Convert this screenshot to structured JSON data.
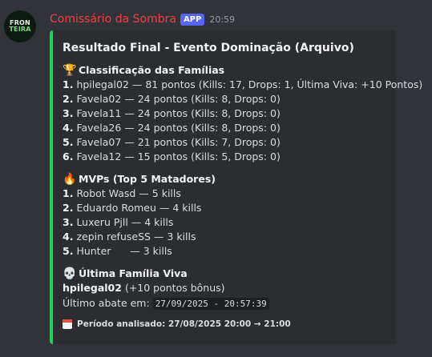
{
  "message": {
    "avatar_lines": [
      "FRON",
      "TEIRA"
    ],
    "author": "Comissário da Sombra",
    "app_tag": "APP",
    "time": "20:59"
  },
  "embed": {
    "accent_color": "#23d160",
    "title": "Resultado Final - Evento Dominação (Arquivo)",
    "families": {
      "heading": "Classificação das Famílias",
      "icon": "trophy-icon",
      "rows": [
        {
          "rank": "1.",
          "text": "hpilegal02 — 81 pontos (Kills: 17, Drops: 1, Última Viva: +10 Pontos)"
        },
        {
          "rank": "2.",
          "text": "Favela02 — 24 pontos (Kills: 8, Drops: 0)"
        },
        {
          "rank": "3.",
          "text": "Favela11 — 24 pontos (Kills: 8, Drops: 0)"
        },
        {
          "rank": "4.",
          "text": "Favela26 — 24 pontos (Kills: 8, Drops: 0)"
        },
        {
          "rank": "5.",
          "text": "Favela07 — 21 pontos (Kills: 7, Drops: 0)"
        },
        {
          "rank": "6.",
          "text": "Favela12 — 15 pontos (Kills: 5, Drops: 0)"
        }
      ]
    },
    "mvps": {
      "heading": "MVPs (Top 5 Matadores)",
      "icon": "fire-icon",
      "rows": [
        {
          "rank": "1.",
          "text": "Robot Wasd — 5 kills"
        },
        {
          "rank": "2.",
          "text": "Eduardo Romeu — 4 kills"
        },
        {
          "rank": "3.",
          "text": "Luxeru Pjll — 4 kills"
        },
        {
          "rank": "4.",
          "text": "zepin refuseSS — 3 kills"
        },
        {
          "rank": "5.",
          "text": "Hunter      — 3 kills"
        }
      ]
    },
    "last_family": {
      "heading": "Última Família Viva",
      "icon": "skull-icon",
      "name": "hpilegal02",
      "bonus": "(+10 pontos bônus)",
      "last_kill_label": "Último abate em:",
      "last_kill_value": "27/09/2025 - 20:57:39"
    },
    "footer": {
      "icon": "calendar-icon",
      "text": "Período analisado: 27/08/2025 20:00 → 21:00"
    }
  }
}
